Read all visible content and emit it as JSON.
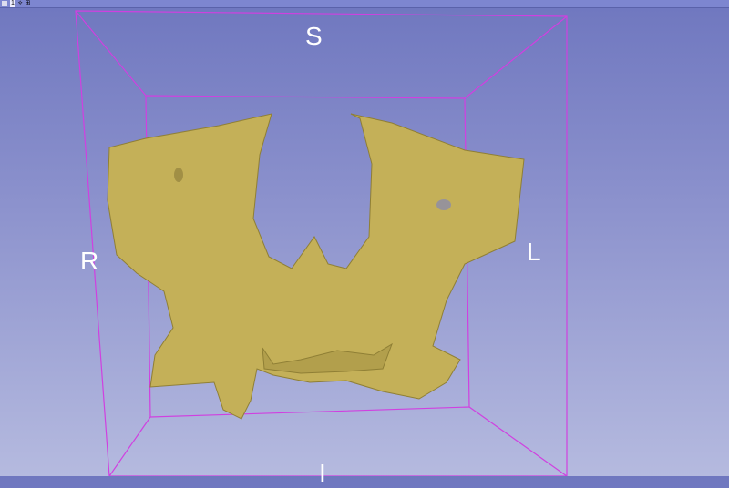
{
  "viewer": {
    "toolbar": {
      "pin_icon": "pin-icon",
      "view_number": "1",
      "link_icon": "link-icon",
      "layout_icon": "layout-icon"
    },
    "orientation": {
      "superior": "S",
      "right": "R",
      "left": "L",
      "inferior": "I"
    },
    "colors": {
      "background_top": "#6f77bf",
      "background_bottom": "#b5badf",
      "bounding_box": "#d040e0",
      "model": "#c4b058"
    }
  }
}
